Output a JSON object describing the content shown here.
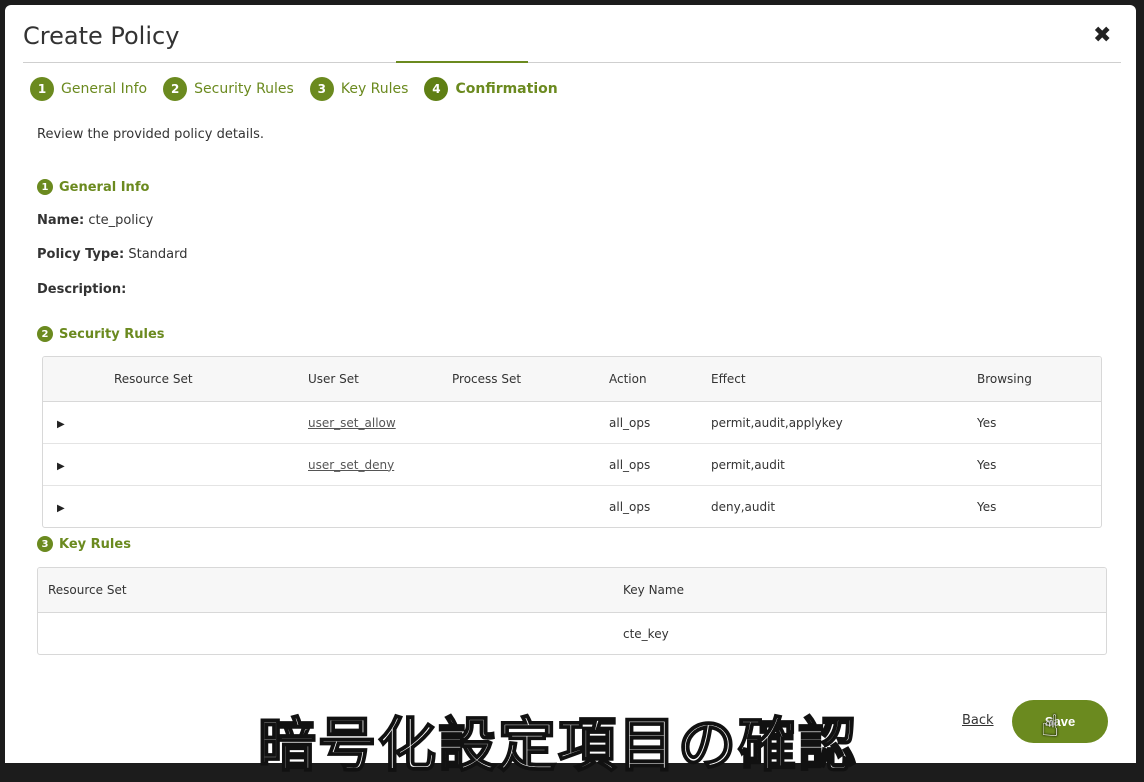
{
  "modal": {
    "title": "Create Policy"
  },
  "tabs": [
    {
      "num": "1",
      "label": "General Info"
    },
    {
      "num": "2",
      "label": "Security Rules"
    },
    {
      "num": "3",
      "label": "Key Rules"
    },
    {
      "num": "4",
      "label": "Confirmation",
      "active": true
    }
  ],
  "intro": "Review the provided policy details.",
  "general": {
    "num": "1",
    "heading": "General Info",
    "name_label": "Name:",
    "name_value": "cte_policy",
    "type_label": "Policy Type:",
    "type_value": "Standard",
    "desc_label": "Description:",
    "desc_value": ""
  },
  "security": {
    "num": "2",
    "heading": "Security Rules",
    "columns": [
      "Resource Set",
      "User Set",
      "Process Set",
      "Action",
      "Effect",
      "Browsing"
    ],
    "rows": [
      {
        "resource": "",
        "user": "user_set_allow",
        "process": "",
        "action": "all_ops",
        "effect": "permit,audit,applykey",
        "browsing": "Yes"
      },
      {
        "resource": "",
        "user": "user_set_deny",
        "process": "",
        "action": "all_ops",
        "effect": "permit,audit",
        "browsing": "Yes"
      },
      {
        "resource": "",
        "user": "",
        "process": "",
        "action": "all_ops",
        "effect": "deny,audit",
        "browsing": "Yes"
      }
    ]
  },
  "keyrules": {
    "num": "3",
    "heading": "Key Rules",
    "columns": [
      "Resource Set",
      "Key Name"
    ],
    "rows": [
      {
        "resource": "",
        "key": "cte_key"
      }
    ]
  },
  "footer": {
    "back": "Back",
    "save": "Save"
  },
  "subtitle": "暗号化設定項目の確認",
  "colors": {
    "accent": "#6b8a1f"
  }
}
